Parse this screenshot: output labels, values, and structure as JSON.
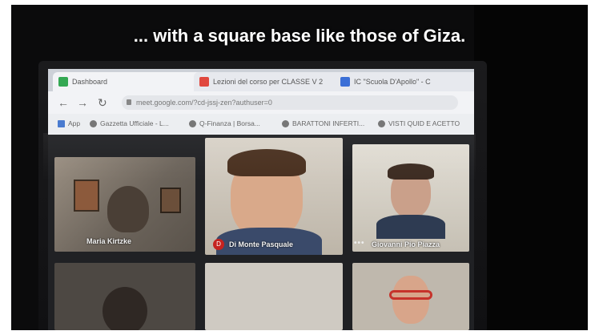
{
  "caption": "... with a square base like those of Giza.",
  "browser": {
    "tabs": [
      {
        "label": "Dashboard",
        "icon": "meet-icon",
        "color": "#34a853"
      },
      {
        "label": "Lezioni del corso per CLASSE V 2",
        "icon": "classroom-icon",
        "color": "#e0483e"
      },
      {
        "label": "IC \"Scuola D'Apollo\" - C",
        "icon": "school-icon",
        "color": "#3b6fd6"
      }
    ],
    "url": "meet.google.com/?cd-jssj-zen?authuser=0",
    "bookmarks": [
      {
        "label": "App"
      },
      {
        "label": "Gazzetta Ufficiale - L..."
      },
      {
        "label": "Q-Finanza | Borsa..."
      },
      {
        "label": "BARATTONI INFERTI..."
      },
      {
        "label": "VISTI QUID E ACETTO"
      }
    ]
  },
  "participants": [
    {
      "name": "Maria Kirtzke"
    },
    {
      "name": "Di Monte Pasquale",
      "badge": "D"
    },
    {
      "name": "Giovanni Pio Piazza",
      "menu": "•••"
    }
  ]
}
